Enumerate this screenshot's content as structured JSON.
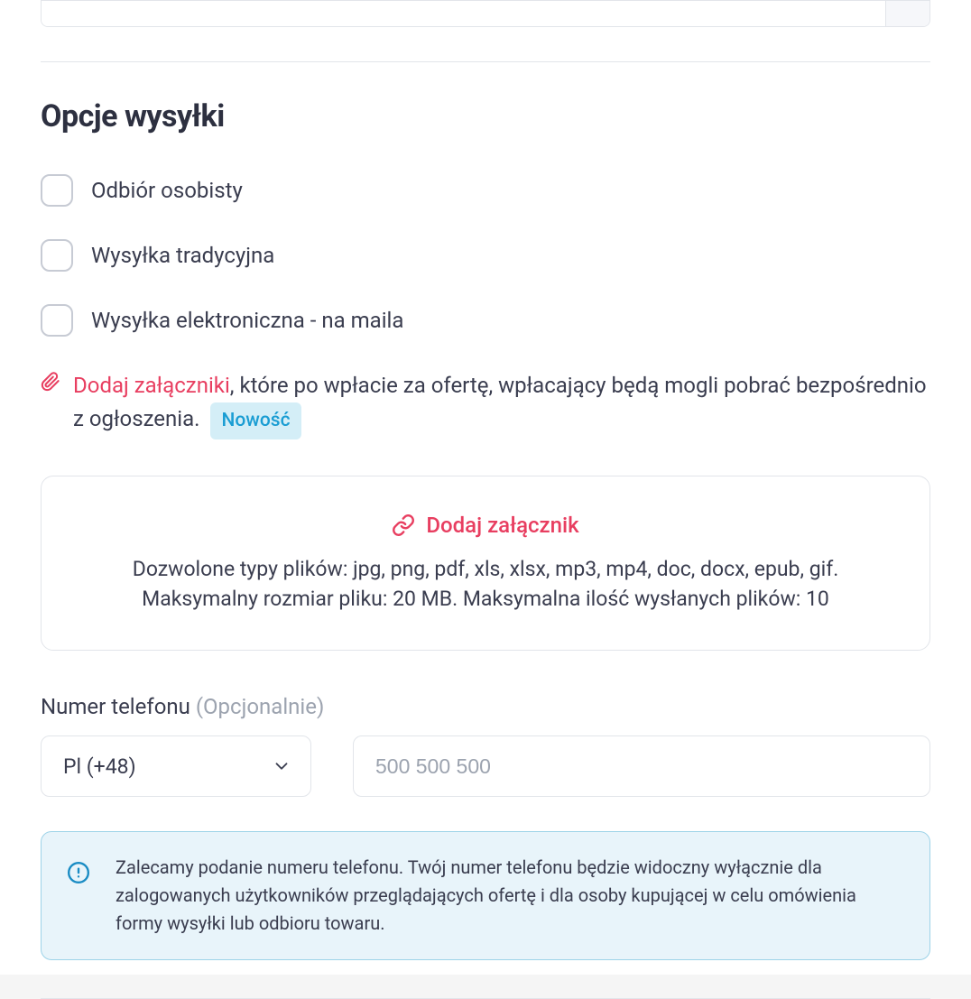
{
  "top_input": {
    "suffix": ""
  },
  "shipping": {
    "title": "Opcje wysyłki",
    "options": [
      {
        "label": "Odbiór osobisty"
      },
      {
        "label": "Wysyłka tradycyjna"
      },
      {
        "label": "Wysyłka elektroniczna - na maila"
      }
    ],
    "attachments_note": {
      "link_text": "Dodaj załączniki",
      "rest_text": ", które po wpłacie za ofertę, wpłacający będą mogli pobrać bezpośrednio z ogłoszenia. ",
      "badge": "Nowość"
    },
    "attachment_box": {
      "link_text": "Dodaj załącznik",
      "line1": "Dozwolone typy plików: jpg, png, pdf, xls, xlsx, mp3, mp4, doc, docx, epub, gif.",
      "line2": "Maksymalny rozmiar pliku: 20 MB. Maksymalna ilość wysłanych plików: 10"
    }
  },
  "phone": {
    "label": "Numer telefonu",
    "optional": "(Opcjonalnie)",
    "prefix_selected": "Pl (+48)",
    "placeholder": "500 500 500"
  },
  "info_banner": {
    "text": "Zalecamy podanie numeru telefonu. Twój numer telefonu będzie widoczny wyłącznie dla zalogowanych użytkowników przeglądających ofertę i dla osoby kupującej w celu omówienia formy wysyłki lub odbioru towaru."
  }
}
